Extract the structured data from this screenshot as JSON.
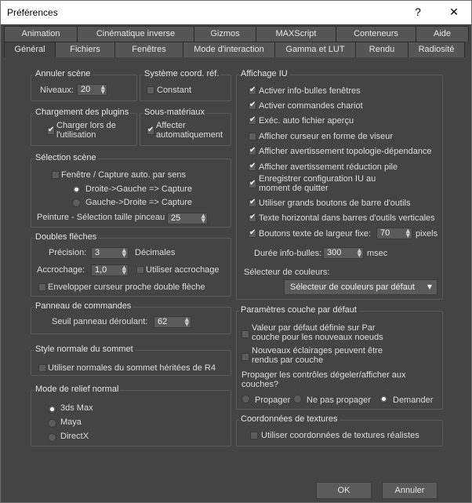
{
  "window": {
    "title": "Préférences",
    "help": "?",
    "close": "✕"
  },
  "tabs_top": [
    "Animation",
    "Cinématique inverse",
    "Gizmos",
    "MAXScript",
    "Conteneurs",
    "Aide"
  ],
  "tabs_bottom": [
    "Général",
    "Fichiers",
    "Fenêtres",
    "Mode d'interaction",
    "Gamma et LUT",
    "Rendu",
    "Radiosité"
  ],
  "undo": {
    "title": "Annuler scène",
    "levels_label": "Niveaux:",
    "levels_value": "20"
  },
  "coord": {
    "title": "Système coord. réf.",
    "constant_label": "Constant"
  },
  "plugins": {
    "title": "Chargement des plugins",
    "load_label": "Charger lors de l'utilisation"
  },
  "submaterials": {
    "title": "Sous-matériaux",
    "assign_label": "Affecter automatiquement"
  },
  "selection": {
    "title": "Sélection scène",
    "auto_label": "Fenêtre / Capture auto. par sens",
    "rtl_label": "Droite->Gauche => Capture",
    "ltr_label": "Gauche->Droite => Capture",
    "brush_label": "Peinture - Sélection taille pinceau",
    "brush_value": "25"
  },
  "spinners": {
    "title": "Doubles flèches",
    "precision_label": "Précision:",
    "precision_value": "3",
    "decimals_label": "Décimales",
    "snap_label": "Accrochage:",
    "snap_value": "1,0",
    "use_snap_label": "Utiliser accrochage",
    "wrap_label": "Envelopper curseur proche double flèche"
  },
  "cmdpanel": {
    "title": "Panneau de commandes",
    "threshold_label": "Seuil panneau déroulant:",
    "threshold_value": "62"
  },
  "vertex_normals": {
    "title": "Style normale du sommet",
    "legacy_label": "Utiliser normales du sommet héritées de R4"
  },
  "bump": {
    "title": "Mode de relief normal",
    "options": [
      "3ds Max",
      "Maya",
      "DirectX"
    ]
  },
  "ui_display": {
    "title": "Affichage IU",
    "options": [
      "Activer info-bulles fenêtres",
      "Activer commandes chariot",
      "Exéc. auto fichier aperçu",
      "Afficher curseur en forme de viseur",
      "Afficher avertissement topologie-dépendance",
      "Afficher avertissement réduction pile",
      "Enregistrer configuration IU au moment de quitter",
      "Utiliser grands boutons de barre d'outils",
      "Texte horizontal dans barres d'outils verticales",
      "Boutons texte de largeur fixe:"
    ],
    "button_width_value": "70",
    "pixels_label": "pixels",
    "tooltip_label": "Durée info-bulles:",
    "tooltip_value": "300",
    "msec_label": "msec",
    "color_label": "Sélecteur de couleurs:",
    "color_value": "Sélecteur de couleurs par défaut"
  },
  "layer": {
    "title": "Paramètres couche par défaut",
    "default_label": "Valeur par défaut définie sur Par couche pour les nouveaux noeuds",
    "lights_label": "Nouveaux éclairages peuvent être rendus par couche",
    "propagate_question": "Propager les contrôles dégeler/afficher aux couches?",
    "radio_options": [
      "Propager",
      "Ne pas propager",
      "Demander"
    ]
  },
  "texture": {
    "title": "Coordonnées de textures",
    "realworld_label": "Utiliser coordonnées de textures réalistes"
  },
  "buttons": {
    "ok": "OK",
    "cancel": "Annuler"
  },
  "colors": {
    "background": "#444444",
    "tab": "#555555",
    "field": "#5a5a5a",
    "text": "#dddddd"
  }
}
